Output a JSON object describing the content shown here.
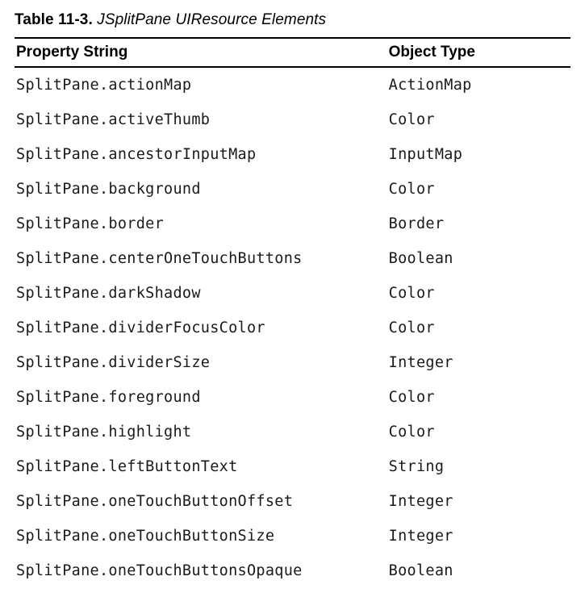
{
  "caption": {
    "label": "Table 11-3.",
    "title": "JSplitPane UIResource Elements"
  },
  "headers": {
    "property": "Property String",
    "type": "Object Type"
  },
  "rows": [
    {
      "property": "SplitPane.actionMap",
      "type": "ActionMap"
    },
    {
      "property": "SplitPane.activeThumb",
      "type": "Color"
    },
    {
      "property": "SplitPane.ancestorInputMap",
      "type": "InputMap"
    },
    {
      "property": "SplitPane.background",
      "type": "Color"
    },
    {
      "property": "SplitPane.border",
      "type": "Border"
    },
    {
      "property": "SplitPane.centerOneTouchButtons",
      "type": "Boolean"
    },
    {
      "property": "SplitPane.darkShadow",
      "type": "Color"
    },
    {
      "property": "SplitPane.dividerFocusColor",
      "type": "Color"
    },
    {
      "property": "SplitPane.dividerSize",
      "type": "Integer"
    },
    {
      "property": "SplitPane.foreground",
      "type": "Color"
    },
    {
      "property": "SplitPane.highlight",
      "type": "Color"
    },
    {
      "property": "SplitPane.leftButtonText",
      "type": "String"
    },
    {
      "property": "SplitPane.oneTouchButtonOffset",
      "type": "Integer"
    },
    {
      "property": "SplitPane.oneTouchButtonSize",
      "type": "Integer"
    },
    {
      "property": "SplitPane.oneTouchButtonsOpaque",
      "type": "Boolean"
    }
  ]
}
